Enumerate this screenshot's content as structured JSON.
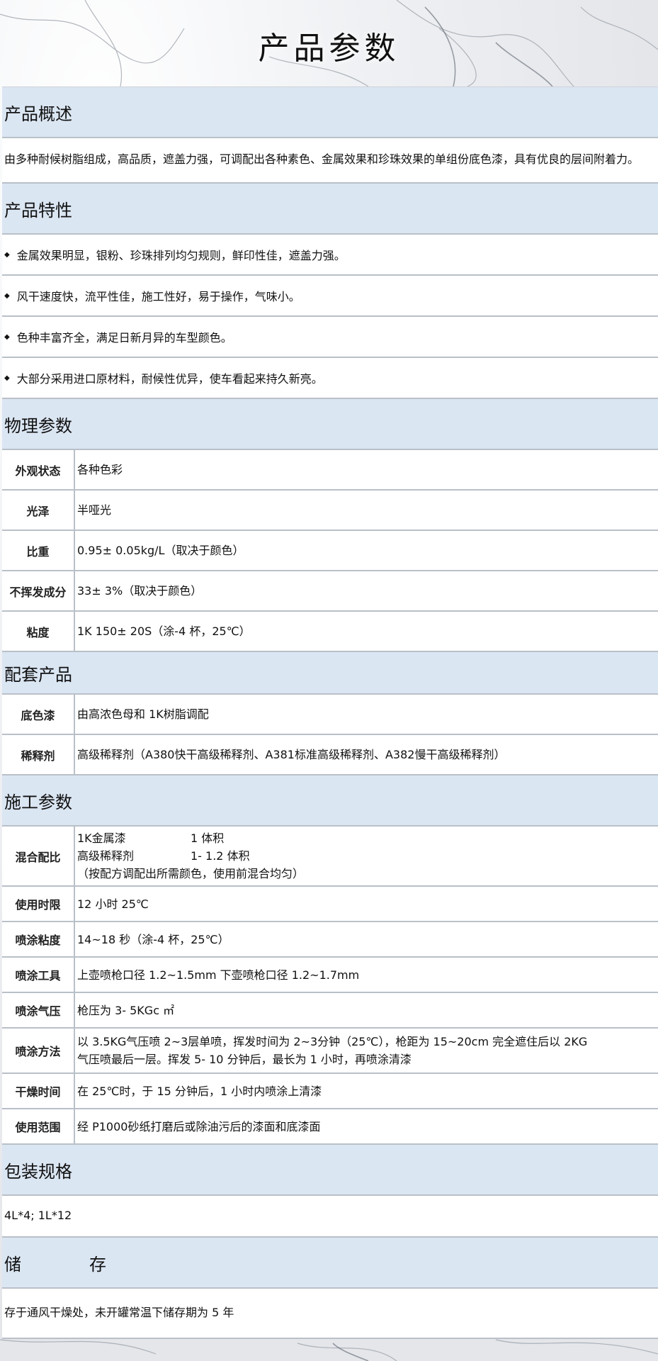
{
  "page_title": "产品参数",
  "overview": {
    "heading": "产品概述",
    "text": "由多种耐候树脂组成，高品质，遮盖力强，可调配出各种素色、金属效果和珍珠效果的单组份底色漆，具有优良的层间附着力。"
  },
  "features": {
    "heading": "产品特性",
    "items": [
      "金属效果明显，银粉、珍珠排列均匀规则，鲜印性佳，遮盖力强。",
      "风干速度快，流平性佳，施工性好，易于操作，气味小。",
      "色种丰富齐全，满足日新月异的车型颜色。",
      "大部分采用进口原材料，耐候性优异，使车看起来持久新亮。"
    ]
  },
  "physical": {
    "heading": "物理参数",
    "rows": [
      {
        "k": "外观状态",
        "v": "各种色彩"
      },
      {
        "k": "光泽",
        "v": "半哑光"
      },
      {
        "k": "比重",
        "v": "0.95± 0.05kg/L（取决于颜色）"
      },
      {
        "k": "不挥发成分",
        "v": "33± 3%（取决于颜色）"
      },
      {
        "k": "粘度",
        "v": "1K 150± 20S（涂-4 杯，25℃）"
      }
    ]
  },
  "matching": {
    "heading": "配套产品",
    "rows": [
      {
        "k": "底色漆",
        "v": "由高浓色母和 1K树脂调配"
      },
      {
        "k": "稀释剂",
        "v": "高级稀释剂（A380快干高级稀释剂、A381标准高级稀释剂、A382慢干高级稀释剂）"
      }
    ]
  },
  "application": {
    "heading": "施工参数",
    "mix": {
      "k": "混合配比",
      "line1_a": "1K金属漆",
      "line1_b": "1 体积",
      "line2_a": "高级稀释剂",
      "line2_b": "1- 1.2 体积",
      "line3": "（按配方调配出所需颜色，使用前混合均匀）"
    },
    "rows": [
      {
        "k": "使用时限",
        "v": "12 小时 25℃"
      },
      {
        "k": "喷涂粘度",
        "v": "14~18 秒（涂-4 杯，25℃）"
      },
      {
        "k": "喷涂工具",
        "v": "上壶喷枪口径 1.2~1.5mm    下壶喷枪口径 1.2~1.7mm"
      },
      {
        "k": "喷涂气压",
        "v": "枪压为 3- 5KGc ㎡"
      }
    ],
    "method": {
      "k": "喷涂方法",
      "line1": "以 3.5KG气压喷 2~3层单喷，挥发时间为 2~3分钟（25℃），枪距为 15~20cm 完全遮住后以 2KG",
      "line2": "气压喷最后一层。挥发 5- 10 分钟后，最长为 1 小时，再喷涂清漆"
    },
    "rows2": [
      {
        "k": "干燥时间",
        "v": "在 25℃时，于 15 分钟后，1 小时内喷涂上清漆"
      },
      {
        "k": "使用范围",
        "v": "经 P1000砂纸打磨后或除油污后的漆面和底漆面"
      }
    ]
  },
  "packaging": {
    "heading": "包装规格",
    "text": "4L*4; 1L*12"
  },
  "storage": {
    "heading": "储　　　　存",
    "text": "存于通风干燥处，未开罐常温下储存期为 5 年"
  }
}
